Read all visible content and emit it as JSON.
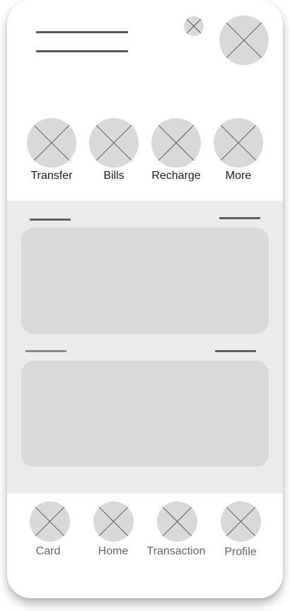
{
  "colors": {
    "placeholder_fill": "#d9d9d9",
    "placeholder_stroke": "#555555",
    "content_background": "#ebebeb",
    "line": "#5e5e5e",
    "label_dark": "#1c1c1c",
    "label_muted": "#666666"
  },
  "header": {
    "menu_icon": "hamburger-menu-icon",
    "notification_icon": "image-placeholder-icon",
    "avatar_icon": "image-placeholder-icon"
  },
  "quick_actions": [
    {
      "label": "Transfer",
      "icon": "image-placeholder-icon"
    },
    {
      "label": "Bills",
      "icon": "image-placeholder-icon"
    },
    {
      "label": "Recharge",
      "icon": "image-placeholder-icon"
    },
    {
      "label": "More",
      "icon": "image-placeholder-icon"
    }
  ],
  "bottom_nav": [
    {
      "label": "Card",
      "icon": "image-placeholder-icon"
    },
    {
      "label": "Home",
      "icon": "image-placeholder-icon"
    },
    {
      "label": "Transaction",
      "icon": "image-placeholder-icon"
    },
    {
      "label": "Profile",
      "icon": "image-placeholder-icon"
    }
  ]
}
